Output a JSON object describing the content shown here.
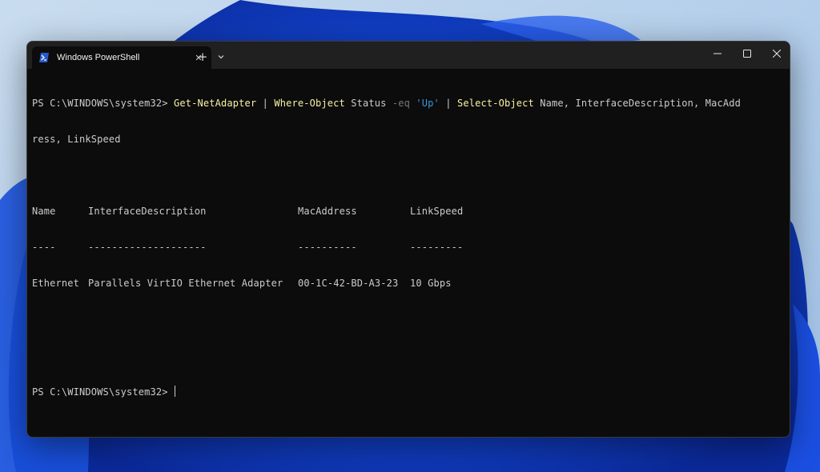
{
  "window": {
    "tab_title": "Windows PowerShell",
    "tab_close": "✕",
    "new_tab": "+"
  },
  "terminal": {
    "prompt": "PS C:\\WINDOWS\\system32>",
    "command": {
      "cmd1": "Get-NetAdapter",
      "pipe1": "|",
      "cmd2": "Where-Object",
      "arg1": "Status",
      "op": "-eq",
      "str": "'Up'",
      "pipe2": "|",
      "cmd3": "Select-Object",
      "args": "Name, InterfaceDescription, MacAdd",
      "args_wrap": "ress, LinkSpeed"
    },
    "table": {
      "headers": [
        "Name",
        "InterfaceDescription",
        "MacAddress",
        "LinkSpeed"
      ],
      "underlines": [
        "----",
        "--------------------",
        "----------",
        "---------"
      ],
      "rows": [
        [
          "Ethernet",
          "Parallels VirtIO Ethernet Adapter",
          "00-1C-42-BD-A3-23",
          "10 Gbps"
        ]
      ]
    },
    "prompt2": "PS C:\\WINDOWS\\system32>"
  },
  "colors": {
    "terminal_bg": "#0c0c0c",
    "titlebar_bg": "#202020",
    "text": "#cccccc",
    "cmdlet": "#f9f1a5",
    "string": "#3a96dd",
    "operator": "#767676"
  },
  "icons": {
    "tab": "powershell-icon",
    "dropdown": "chevron-down-icon",
    "minimize": "minimize-icon",
    "maximize": "maximize-icon",
    "close": "close-icon"
  }
}
